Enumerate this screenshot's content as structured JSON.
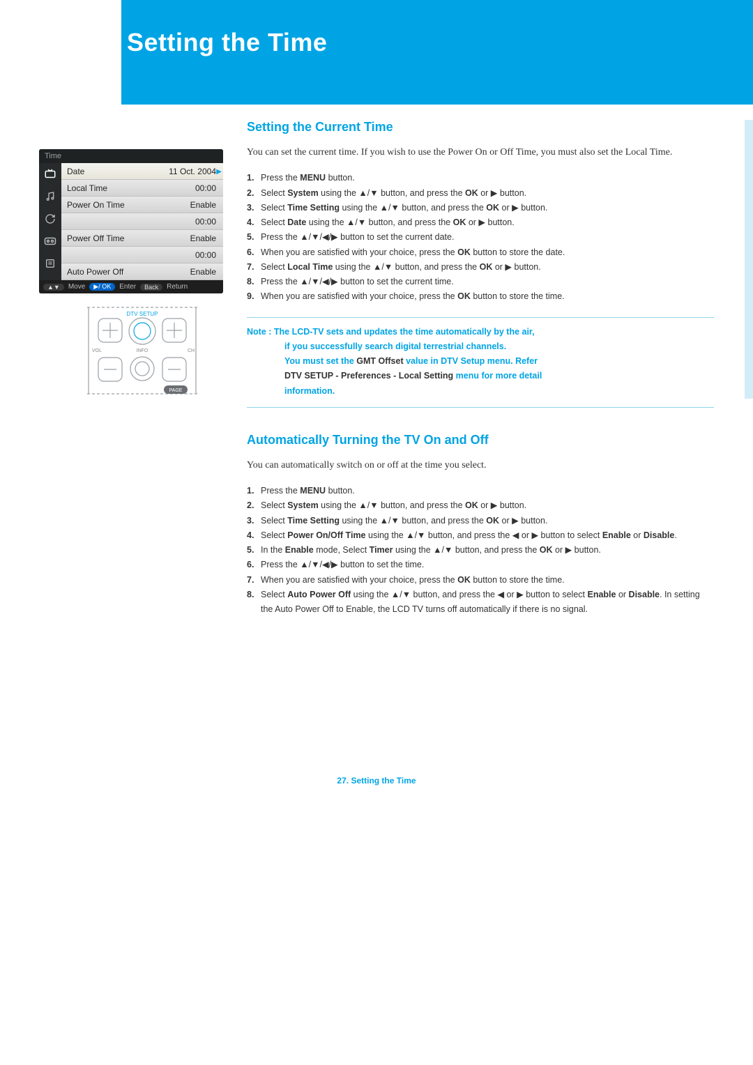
{
  "header": {
    "title": "Setting the Time"
  },
  "section1": {
    "title": "Setting the Current Time",
    "intro": "You can set the current time. If you wish to use the Power On or Off Time, you must also set the Local Time.",
    "steps": [
      {
        "n": "1.",
        "pre": "Press the ",
        "bold": "MENU",
        "post": " button."
      },
      {
        "n": "2.",
        "pre": "Select ",
        "bold": "System",
        "post": " using the ▲/▼ button, and press the ",
        "bold2": "OK",
        "post2": " or ▶ button."
      },
      {
        "n": "3.",
        "pre": "Select ",
        "bold": "Time Setting",
        "post": " using the ▲/▼ button, and press the ",
        "bold2": "OK",
        "post2": " or ▶ button."
      },
      {
        "n": "4.",
        "pre": "Select ",
        "bold": "Date",
        "post": " using the ▲/▼ button, and press the ",
        "bold2": "OK",
        "post2": " or ▶ button."
      },
      {
        "n": "5.",
        "pre": "Press the ▲/▼/◀/▶ button to set the current date."
      },
      {
        "n": "6.",
        "pre": "When you are satisfied with your choice, press the ",
        "bold": "OK",
        "post": " button to store the date."
      },
      {
        "n": "7.",
        "pre": "Select ",
        "bold": "Local Time",
        "post": " using the ▲/▼ button, and press the ",
        "bold2": "OK",
        "post2": " or ▶ button."
      },
      {
        "n": "8.",
        "pre": "Press the ▲/▼/◀/▶ button to set the current time."
      },
      {
        "n": "9.",
        "pre": "When you are satisfied with your choice, press the ",
        "bold": "OK",
        "post": "  button to store the time."
      }
    ],
    "note_lines": [
      {
        "prefix": "Note : ",
        "text": "The LCD-TV sets and updates the time automatically by the air,"
      },
      {
        "prefix": "",
        "text": "if you successfully search digital terrestrial channels."
      },
      {
        "prefix": "",
        "text": "You must set the ",
        "accent": "GMT Offset",
        "text2": " value in DTV Setup menu. Refer"
      },
      {
        "prefix": "",
        "text": "",
        "accent": "DTV SETUP - Preferences - Local Setting",
        "text2": " menu for more detail"
      },
      {
        "prefix": "",
        "text": "information."
      }
    ]
  },
  "section2": {
    "title": "Automatically Turning the TV On and Off",
    "intro": "You can automatically switch on or off at the time you select.",
    "steps": [
      {
        "n": "1.",
        "pre": "Press the ",
        "bold": "MENU",
        "post": " button."
      },
      {
        "n": "2",
        "dot": ".",
        "pre": " Select ",
        "bold": "System",
        "post": " using the ▲/▼ button, and press the ",
        "bold2": "OK",
        "post2": " or ▶ button."
      },
      {
        "n": "3.",
        "pre": "Select ",
        "bold": "Time Setting",
        "post": " using the ▲/▼ button, and press the ",
        "bold2": "OK",
        "post2": " or ▶ button."
      },
      {
        "n": "4.",
        "pre": "Select ",
        "bold": "Power On/Off Time",
        "post": " using the ▲/▼ button, and press the ◀ or ▶ button to select ",
        "bold2": "Enable",
        "post2": " or ",
        "bold3": "Disable",
        "post3": "."
      },
      {
        "n": "5.",
        "pre": "In the ",
        "bold": "Enable",
        "post": " mode, Select ",
        "bold2": "Timer",
        "post2": " using the ▲/▼ button, and press the ",
        "bold3": "OK",
        "post3": " or ▶ button."
      },
      {
        "n": "6.",
        "pre": "Press the ▲/▼/◀/▶ button to set the time."
      },
      {
        "n": "7.",
        "pre": "When you are satisfied with your choice, press the ",
        "bold": "OK",
        "post": " button to store the time."
      },
      {
        "n": "8.",
        "pre": "Select ",
        "bold": "Auto Power Off",
        "post": " using the ▲/▼ button, and press the ◀ or ▶ button to select ",
        "bold2": "Enable",
        "post2": " or ",
        "bold3": "Disable",
        "post3": ". In setting the Auto Power Off to Enable, the LCD TV turns off automatically if there is no signal."
      }
    ]
  },
  "menu": {
    "title": "Time",
    "rows": [
      {
        "label": "Date",
        "value": "11 Oct. 2004",
        "selected": true
      },
      {
        "label": "Local Time",
        "value": "00:00"
      },
      {
        "label": "Power On Time",
        "value": "Enable"
      },
      {
        "label": "",
        "value": "00:00"
      },
      {
        "label": "Power Off Time",
        "value": "Enable"
      },
      {
        "label": "",
        "value": "00:00"
      },
      {
        "label": "Auto Power Off",
        "value": "Enable"
      }
    ],
    "footer": {
      "move": "Move",
      "enter": "Enter",
      "back": "Back",
      "ret": "Return",
      "ok": "▶/ OK"
    }
  },
  "remote": {
    "dtv": "DTV SETUP",
    "vol": "VOL",
    "ch": "CH",
    "info": "INFO",
    "page": "PAGE"
  },
  "footer": {
    "text": "27. Setting the Time"
  }
}
